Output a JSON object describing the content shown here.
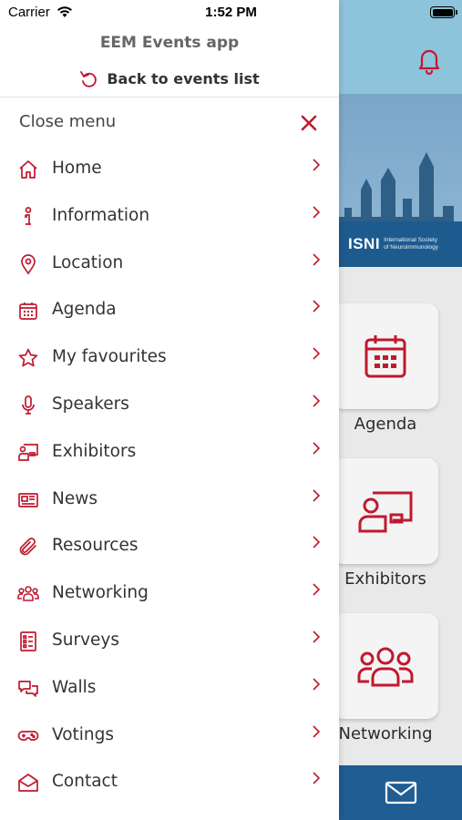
{
  "status_bar": {
    "carrier": "Carrier",
    "time": "1:52 PM"
  },
  "colors": {
    "accent": "#c0192f",
    "header_bg": "#8ec3dc",
    "brand_blue": "#1f5d93"
  },
  "drawer": {
    "app_title": "EEM Events app",
    "back_label": "Back to events list",
    "close_label": "Close menu",
    "items": [
      {
        "label": "Home",
        "icon": "home-icon"
      },
      {
        "label": "Information",
        "icon": "info-icon"
      },
      {
        "label": "Location",
        "icon": "location-pin-icon"
      },
      {
        "label": "Agenda",
        "icon": "calendar-icon"
      },
      {
        "label": "My favourites",
        "icon": "star-icon"
      },
      {
        "label": "Speakers",
        "icon": "microphone-icon"
      },
      {
        "label": "Exhibitors",
        "icon": "presenter-icon"
      },
      {
        "label": "News",
        "icon": "newspaper-icon"
      },
      {
        "label": "Resources",
        "icon": "paperclip-icon"
      },
      {
        "label": "Networking",
        "icon": "people-icon"
      },
      {
        "label": "Surveys",
        "icon": "checklist-icon"
      },
      {
        "label": "Walls",
        "icon": "chat-bubbles-icon"
      },
      {
        "label": "Votings",
        "icon": "gamepad-icon"
      },
      {
        "label": "Contact",
        "icon": "envelope-open-icon"
      }
    ]
  },
  "background": {
    "isni_logo": "ISNI",
    "isni_sub_1": "International Society",
    "isni_sub_2": "of Neuroimmunology",
    "tiles": [
      {
        "label": "Agenda",
        "icon": "calendar-icon"
      },
      {
        "label": "Exhibitors",
        "icon": "presenter-icon"
      },
      {
        "label": "Networking",
        "icon": "people-icon"
      }
    ]
  }
}
